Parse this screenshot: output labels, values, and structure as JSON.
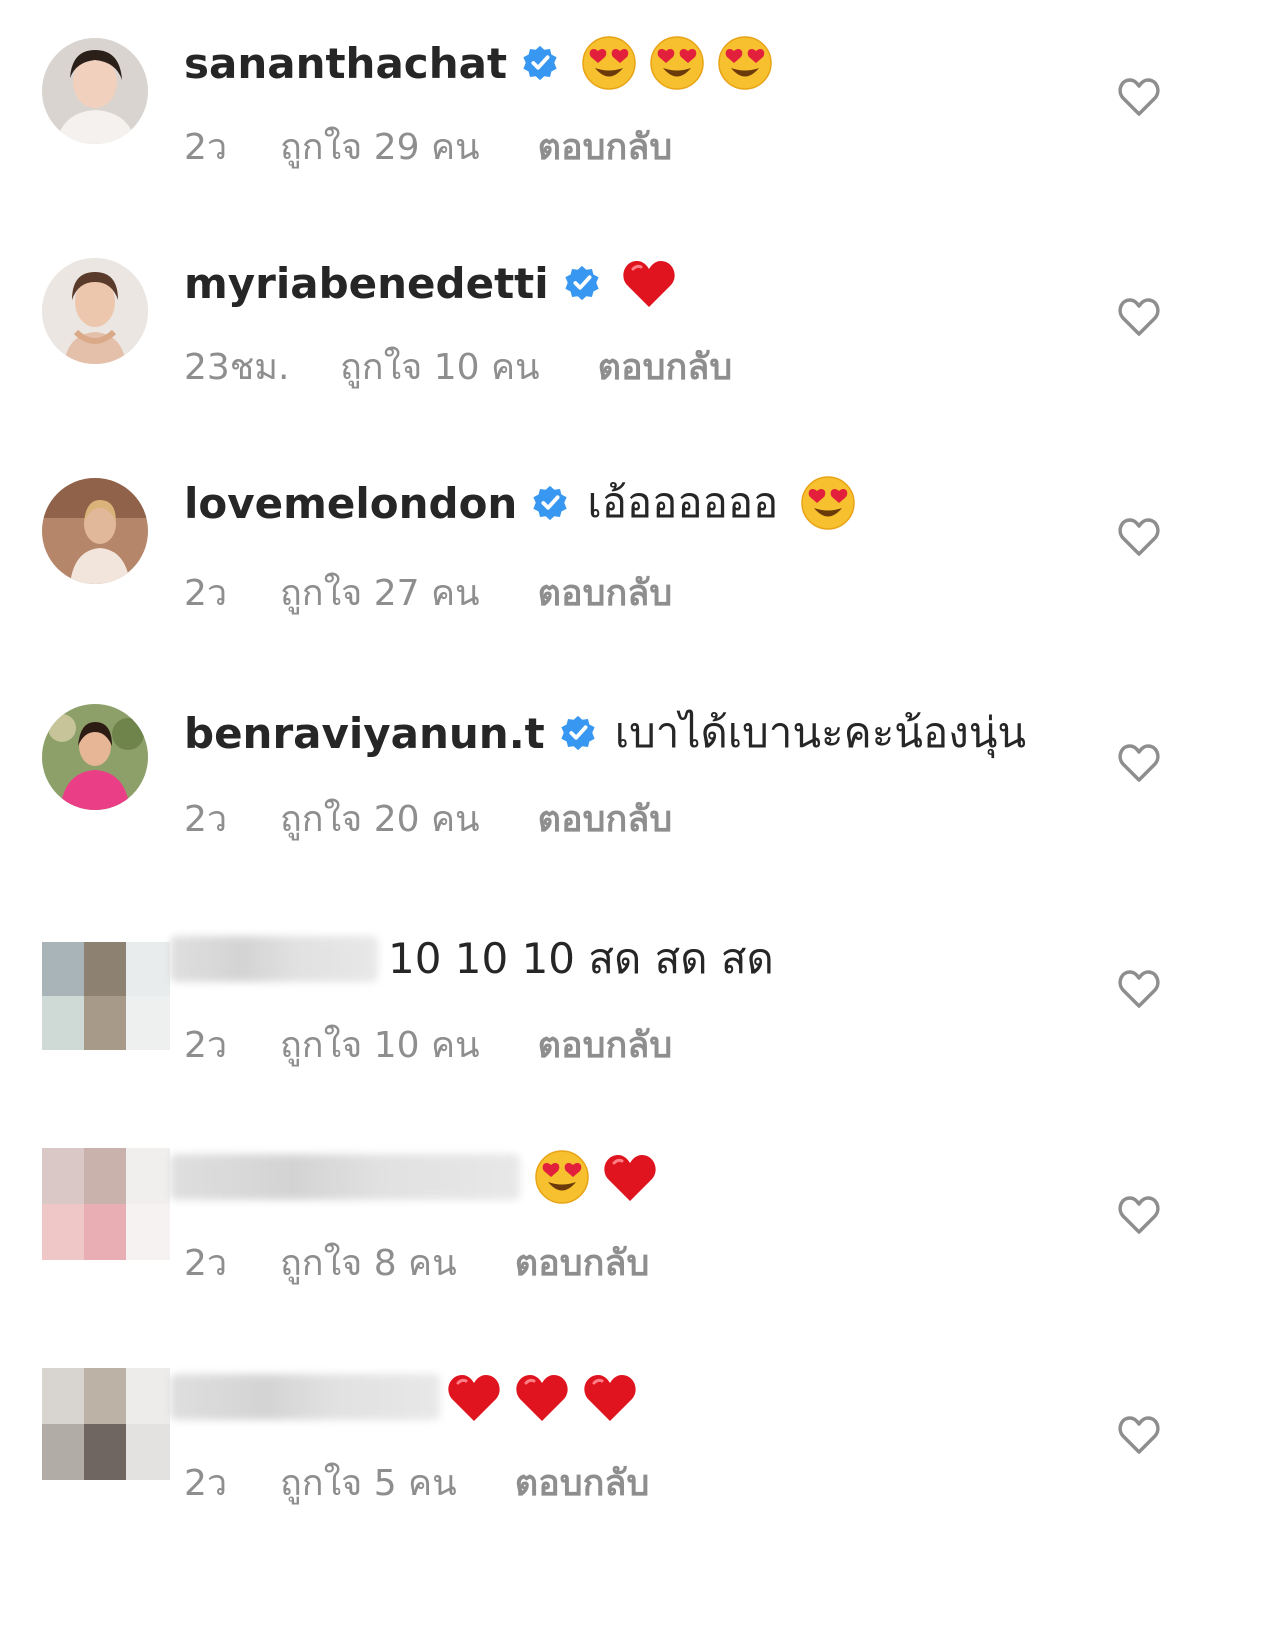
{
  "comments": [
    {
      "username": "sanantha­chat",
      "verified": true,
      "text": "",
      "emojis": [
        "heart-eyes",
        "heart-eyes",
        "heart-eyes"
      ],
      "time": "2ว",
      "likes": "ถูกใจ 29 คน",
      "reply": "ตอบกลับ"
    },
    {
      "username": "myriabenedetti",
      "verified": true,
      "text": "",
      "emojis": [
        "red-heart"
      ],
      "time": "23ชม.",
      "likes": "ถูกใจ 10 คน",
      "reply": "ตอบกลับ"
    },
    {
      "username": "lovemelondon",
      "verified": true,
      "text": "เอ้ออออออ",
      "emojis": [
        "heart-eyes"
      ],
      "time": "2ว",
      "likes": "ถูกใจ 27 คน",
      "reply": "ตอบกลับ"
    },
    {
      "username": "benraviyanun.t",
      "verified": true,
      "text": "เบาได้เบานะคะน้องนุ่น",
      "emojis": [],
      "time": "2ว",
      "likes": "ถูกใจ 20 คน",
      "reply": "ตอบกลับ"
    },
    {
      "username": "",
      "verified": false,
      "text": "10 10 10 สด สด สด",
      "emojis": [],
      "time": "2ว",
      "likes": "ถูกใจ 10 คน",
      "reply": "ตอบกลับ"
    },
    {
      "username": "",
      "verified": false,
      "text": "",
      "emojis": [
        "heart-eyes",
        "red-heart"
      ],
      "time": "2ว",
      "likes": "ถูกใจ 8 คน",
      "reply": "ตอบกลับ"
    },
    {
      "username": "",
      "verified": false,
      "text": "",
      "emojis": [
        "red-heart",
        "red-heart",
        "red-heart"
      ],
      "time": "2ว",
      "likes": "ถูกใจ 5 คน",
      "reply": "ตอบกลับ"
    }
  ],
  "colors": {
    "verified": "#3897f0",
    "meta": "#8e8e8e",
    "text": "#262626",
    "heart": "#e0141e"
  },
  "icons": {
    "like": "heart-outline-icon",
    "verified": "verified-badge-icon"
  }
}
